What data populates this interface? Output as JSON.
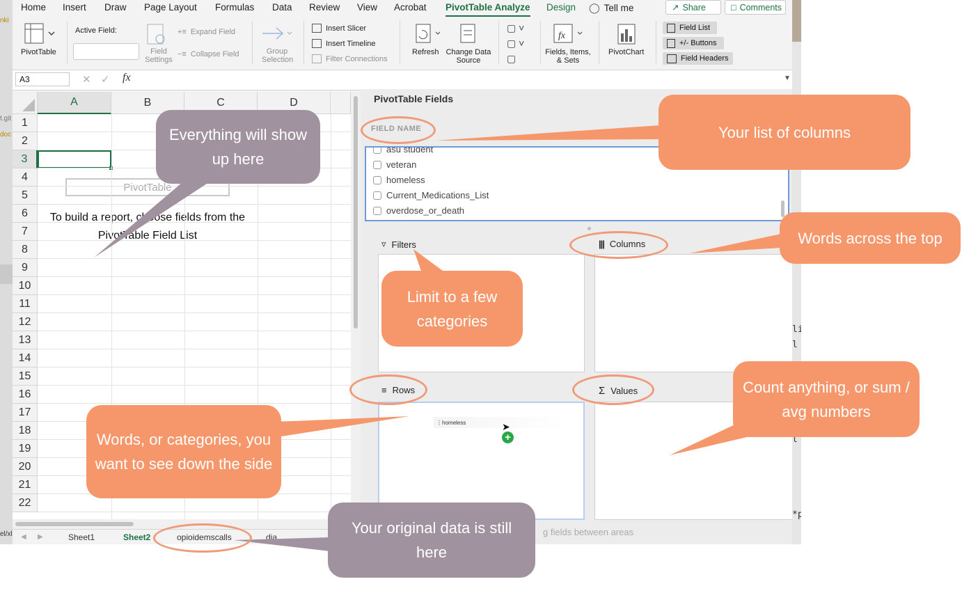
{
  "ribbon": {
    "tabs": [
      "Home",
      "Insert",
      "Draw",
      "Page Layout",
      "Formulas",
      "Data",
      "Review",
      "View",
      "Acrobat",
      "PivotTable Analyze",
      "Design"
    ],
    "tell_me": "Tell me",
    "share": "Share",
    "comments": "Comments",
    "pivottable": "PivotTable",
    "active_field": "Active Field:",
    "field_settings": "Field Settings",
    "expand_field": "Expand Field",
    "collapse_field": "Collapse Field",
    "group_selection": "Group Selection",
    "insert_slicer": "Insert Slicer",
    "insert_timeline": "Insert Timeline",
    "filter_connections": "Filter Connections",
    "refresh": "Refresh",
    "change_data_source": "Change Data Source",
    "fields_items_sets": "Fields, Items, & Sets",
    "pivotchart": "PivotChart",
    "field_list": "Field List",
    "plus_minus_buttons": "+/- Buttons",
    "field_headers": "Field Headers"
  },
  "formula_bar": {
    "name_box": "A3",
    "fx": "fx",
    "value": ""
  },
  "grid": {
    "columns": [
      "A",
      "B",
      "C",
      "D"
    ],
    "rows": [
      "1",
      "2",
      "3",
      "4",
      "5",
      "6",
      "7",
      "8",
      "9",
      "10",
      "11",
      "12",
      "13",
      "14",
      "15",
      "16",
      "17",
      "18",
      "19",
      "20",
      "21",
      "22"
    ],
    "placeholder_title": "PivotTable",
    "placeholder_text_1": "To build a report, choose fields from the",
    "placeholder_text_2": "PivotTable Field List"
  },
  "pane": {
    "title": "PivotTable Fields",
    "field_name_header": "FIELD NAME",
    "fields": [
      "asu student",
      "veteran",
      "homeless",
      "Current_Medications_List",
      "overdose_or_death"
    ],
    "filters": "Filters",
    "columns": "Columns",
    "rows": "Rows",
    "values": "Values",
    "drag_item": "homeless",
    "footer_hint": "g fields between areas"
  },
  "sheets": [
    "Sheet1",
    "Sheet2",
    "opioidemscalls",
    "dia"
  ],
  "left_strip": [
    "nki",
    "t.git",
    "doc",
    "el/xl"
  ],
  "right_strip": [
    "li",
    "l",
    "l",
    "*p"
  ],
  "annotations": {
    "everything": "Everything will show up here",
    "columns_list": "Your list of columns",
    "words_top": "Words across the top",
    "limit": "Limit to a few categories",
    "count": "Count anything, or sum / avg numbers",
    "words_side": "Words, or categories, you want to see down the side",
    "original": "Your original data is still here"
  },
  "colors": {
    "excel_green": "#1e7145",
    "annotation_orange": "#f6966b",
    "annotation_mauve": "#a0929f",
    "ellipse": "#ef9a78"
  }
}
